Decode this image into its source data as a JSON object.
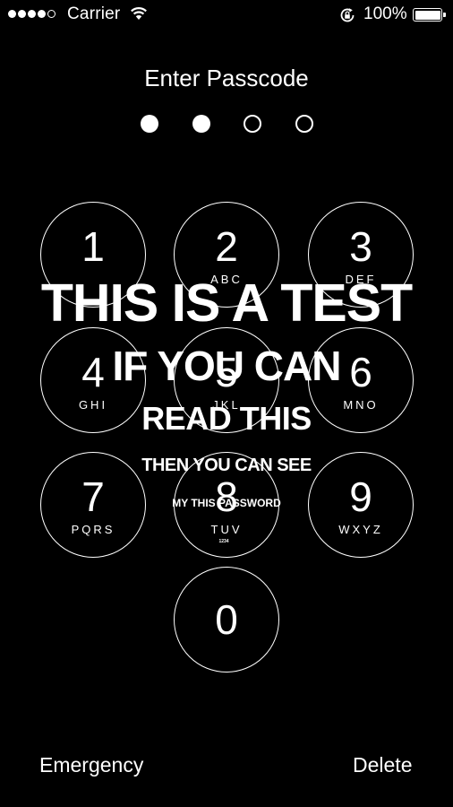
{
  "status_bar": {
    "signal_bars_filled": 4,
    "signal_bars_total": 5,
    "carrier": "Carrier",
    "battery_percent": "100%"
  },
  "title": "Enter Passcode",
  "passcode": {
    "entered": 2,
    "length": 4
  },
  "keypad": [
    {
      "digit": "1",
      "letters": ""
    },
    {
      "digit": "2",
      "letters": "ABC"
    },
    {
      "digit": "3",
      "letters": "DEF"
    },
    {
      "digit": "4",
      "letters": "GHI"
    },
    {
      "digit": "5",
      "letters": "JKL"
    },
    {
      "digit": "6",
      "letters": "MNO"
    },
    {
      "digit": "7",
      "letters": "PQRS"
    },
    {
      "digit": "8",
      "letters": "TUV"
    },
    {
      "digit": "9",
      "letters": "WXYZ"
    },
    {
      "digit": "0",
      "letters": ""
    }
  ],
  "overlay": {
    "line1": "THIS IS A TEST",
    "line2": "IF YOU CAN",
    "line3": "READ THIS",
    "line4": "THEN YOU CAN SEE",
    "line5": "MY THIS PASSWORD",
    "line6": "1234"
  },
  "buttons": {
    "emergency": "Emergency",
    "delete": "Delete"
  }
}
